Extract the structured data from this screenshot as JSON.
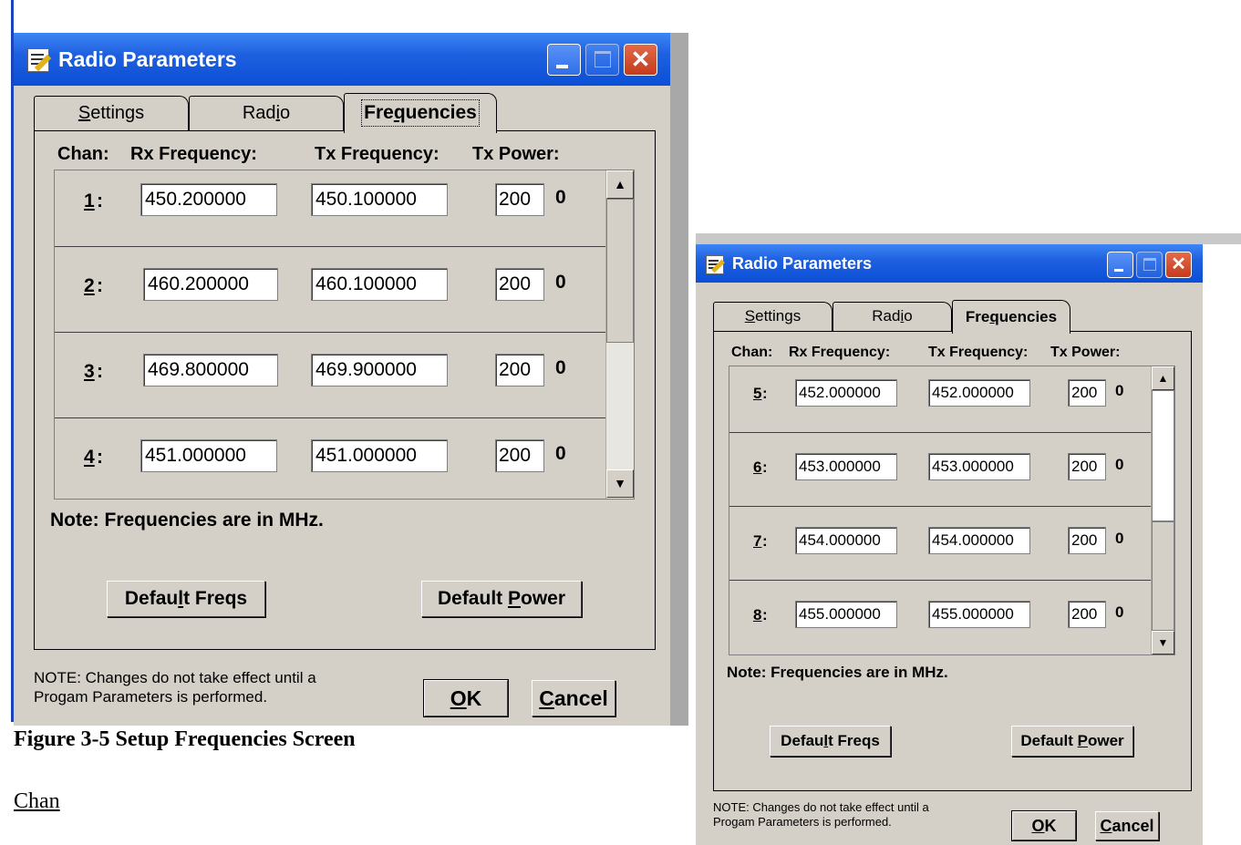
{
  "document": {
    "caption": "Figure 3-5   Setup Frequencies Screen",
    "chan_heading": "Chan"
  },
  "win1": {
    "title": "Radio Parameters",
    "tabs": [
      {
        "label": "Settings",
        "mnemonic": "S",
        "rest": "ettings"
      },
      {
        "label": "Radio",
        "pre": "Rad",
        "mnemonic": "i",
        "rest": "o"
      },
      {
        "label": "Frequencies",
        "pre": "Fre",
        "mnemonic": "q",
        "rest": "uencies"
      }
    ],
    "headers": {
      "chan": "Chan:",
      "rx": "Rx Frequency:",
      "tx": "Tx Frequency:",
      "power": "Tx Power:"
    },
    "channels": [
      {
        "num": "1",
        "rx": "450.200000",
        "tx": "450.100000",
        "power": "200",
        "level": "0"
      },
      {
        "num": "2",
        "rx": "460.200000",
        "tx": "460.100000",
        "power": "200",
        "level": "0"
      },
      {
        "num": "3",
        "rx": "469.800000",
        "tx": "469.900000",
        "power": "200",
        "level": "0"
      },
      {
        "num": "4",
        "rx": "451.000000",
        "tx": "451.000000",
        "power": "200",
        "level": "0"
      }
    ],
    "note": "Note: Frequencies are in MHz.",
    "default_freqs": {
      "pre": "Defau",
      "mnemonic": "l",
      "rest": "t Freqs"
    },
    "default_power": {
      "pre": "Default ",
      "mnemonic": "P",
      "rest": "ower"
    },
    "footnote_line1": "NOTE:  Changes do not take effect until a",
    "footnote_line2": "Progam Parameters is performed.",
    "ok": {
      "mnemonic": "O",
      "rest": "K"
    },
    "cancel": {
      "mnemonic": "C",
      "rest": "ancel"
    },
    "scroll_position": 0.0
  },
  "win2": {
    "title": "Radio Parameters",
    "tabs": [
      {
        "label": "Settings",
        "mnemonic": "S",
        "rest": "ettings"
      },
      {
        "label": "Radio",
        "pre": "Rad",
        "mnemonic": "i",
        "rest": "o"
      },
      {
        "label": "Frequencies",
        "pre": "Fre",
        "mnemonic": "q",
        "rest": "uencies"
      }
    ],
    "headers": {
      "chan": "Chan:",
      "rx": "Rx Frequency:",
      "tx": "Tx Frequency:",
      "power": "Tx Power:"
    },
    "channels": [
      {
        "num": "5",
        "rx": "452.000000",
        "tx": "452.000000",
        "power": "200",
        "level": "0"
      },
      {
        "num": "6",
        "rx": "453.000000",
        "tx": "453.000000",
        "power": "200",
        "level": "0"
      },
      {
        "num": "7",
        "rx": "454.000000",
        "tx": "454.000000",
        "power": "200",
        "level": "0"
      },
      {
        "num": "8",
        "rx": "455.000000",
        "tx": "455.000000",
        "power": "200",
        "level": "0"
      }
    ],
    "note": "Note: Frequencies are in MHz.",
    "default_freqs": {
      "pre": "Defau",
      "mnemonic": "l",
      "rest": "t Freqs"
    },
    "default_power": {
      "pre": "Default ",
      "mnemonic": "P",
      "rest": "ower"
    },
    "footnote_line1": "NOTE:  Changes do not take effect until a",
    "footnote_line2": "Progam Parameters is performed.",
    "ok": {
      "mnemonic": "O",
      "rest": "K"
    },
    "cancel": {
      "mnemonic": "C",
      "rest": "ancel"
    },
    "scroll_position": 0.5
  },
  "colors": {
    "titlebar": "#0a4fd6",
    "dialog_bg": "#d4d0c8",
    "close_button": "#c53b1d",
    "page_bar": "#1b44b8"
  },
  "icons": [
    "notepad-icon",
    "minimize-icon",
    "maximize-icon",
    "close-icon",
    "scroll-up-arrow-icon",
    "scroll-down-arrow-icon"
  ]
}
